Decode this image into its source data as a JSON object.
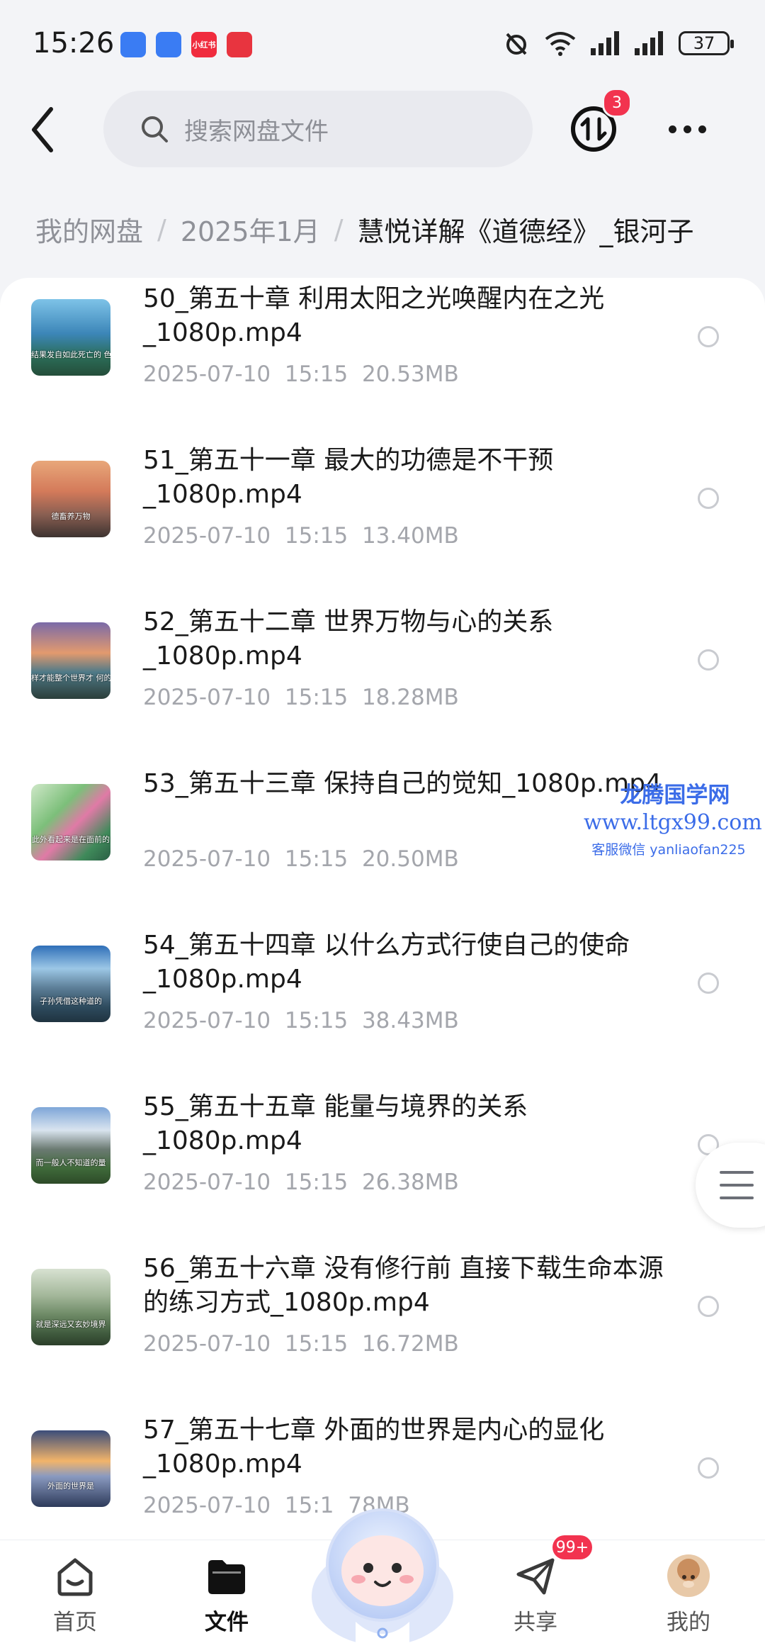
{
  "status_bar": {
    "time": "15:26",
    "app_labels": [
      "",
      "",
      "小红书",
      ""
    ],
    "battery": "37"
  },
  "top_bar": {
    "search_placeholder": "搜索网盘文件",
    "transfer_badge": "3"
  },
  "breadcrumb": {
    "items": [
      "我的网盘",
      "2025年1月"
    ],
    "current": "慧悦详解《道德经》_银河子"
  },
  "files": [
    {
      "name": "50_第五十章 利用太阳之光唤醒内在之光_1080p.mp4",
      "date": "2025-07-10",
      "time": "15:15",
      "size": "20.53MB",
      "thumb_caption": "结果发自如此死亡的 色灼灼，于是为之三"
    },
    {
      "name": "51_第五十一章 最大的功德是不干预_1080p.mp4",
      "date": "2025-07-10",
      "time": "15:15",
      "size": "13.40MB",
      "thumb_caption": "德畜养万物"
    },
    {
      "name": "52_第五十二章 世界万物与心的关系_1080p.mp4",
      "date": "2025-07-10",
      "time": "15:15",
      "size": "18.28MB",
      "thumb_caption": "样才能整个世界才 何的心"
    },
    {
      "name": "53_第五十三章 保持自己的觉知_1080p.mp4",
      "date": "2025-07-10",
      "time": "15:15",
      "size": "20.50MB",
      "thumb_caption": "此外看起来是在面前的"
    },
    {
      "name": "54_第五十四章 以什么方式行使自己的使命_1080p.mp4",
      "date": "2025-07-10",
      "time": "15:15",
      "size": "38.43MB",
      "thumb_caption": "子孙凭借这种道的"
    },
    {
      "name": "55_第五十五章  能量与境界的关系_1080p.mp4",
      "date": "2025-07-10",
      "time": "15:15",
      "size": "26.38MB",
      "thumb_caption": "而一般人不知道的量"
    },
    {
      "name": "56_第五十六章 没有修行前 直接下载生命本源的练习方式_1080p.mp4",
      "date": "2025-07-10",
      "time": "15:15",
      "size": "16.72MB",
      "thumb_caption": "就是深远又玄妙境界"
    },
    {
      "name": "57_第五十七章 外面的世界是内心的显化_1080p.mp4",
      "date": "2025-07-10",
      "time": "15:1",
      "size": "78MB",
      "thumb_caption": "外面的世界是"
    }
  ],
  "watermark": {
    "title": "龙腾国学网",
    "url": "www.ltgx99.com",
    "service": "客服微信 yanliaofan225"
  },
  "tabs": [
    {
      "label": "首页",
      "icon": "home-icon",
      "active": false
    },
    {
      "label": "文件",
      "icon": "folder-icon",
      "active": true
    },
    {
      "label": "共享",
      "icon": "paper-plane-icon",
      "active": false,
      "badge": "99+"
    },
    {
      "label": "我的",
      "icon": "avatar-icon",
      "active": false
    }
  ],
  "colors": {
    "accent_red": "#f2334f",
    "watermark_blue": "#3b6ce8",
    "text_primary": "#1a1a1a",
    "text_secondary": "#a4a6ac"
  }
}
